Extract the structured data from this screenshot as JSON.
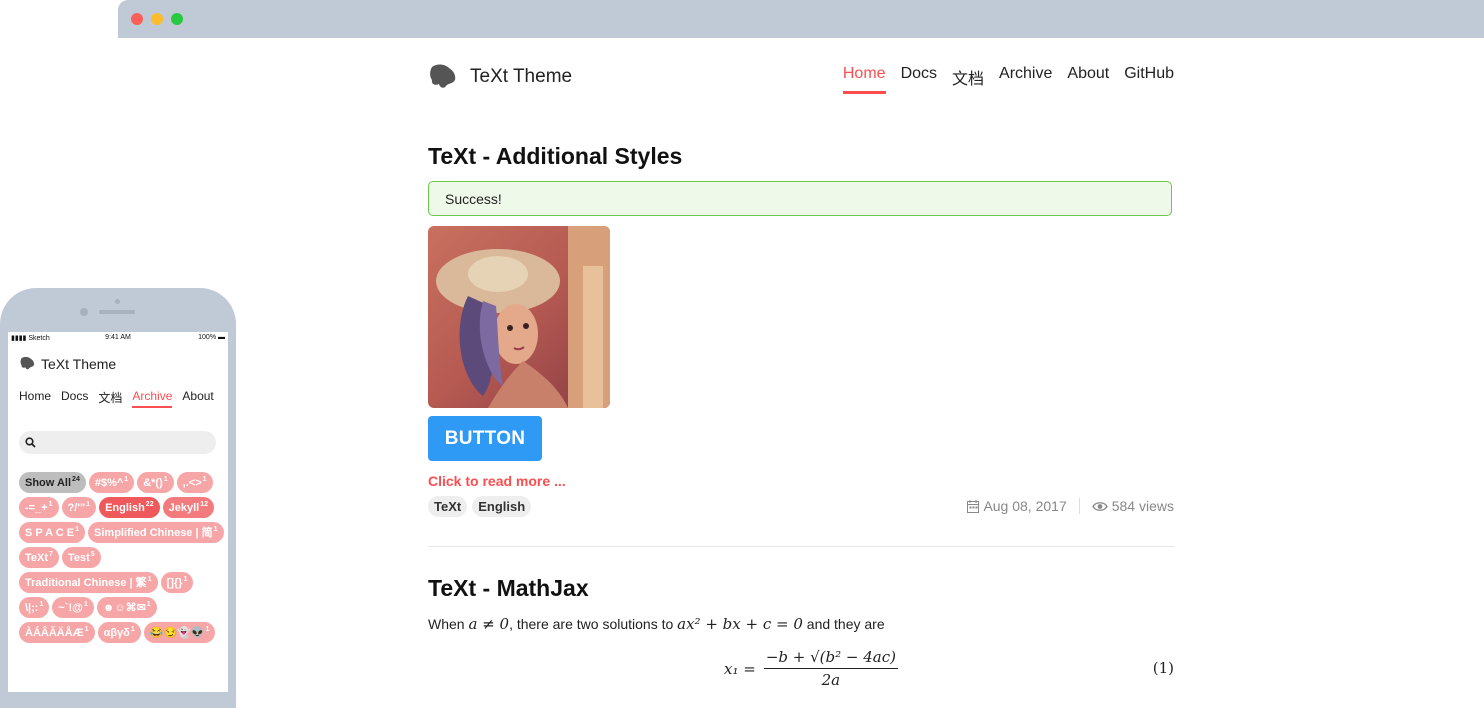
{
  "desktop": {
    "site_title": "TeXt Theme",
    "nav": [
      {
        "label": "Home",
        "active": true
      },
      {
        "label": "Docs",
        "active": false
      },
      {
        "label": "文档",
        "active": false
      },
      {
        "label": "Archive",
        "active": false
      },
      {
        "label": "About",
        "active": false
      },
      {
        "label": "GitHub",
        "active": false
      }
    ],
    "post1": {
      "title": "TeXt - Additional Styles",
      "alert": "Success!",
      "button_label": "BUTTON",
      "read_more": "Click to read more ...",
      "tags": [
        "TeXt",
        "English"
      ],
      "date": "Aug 08, 2017",
      "views": "584 views"
    },
    "post2": {
      "title": "TeXt - MathJax",
      "text_before": "When ",
      "cond": "a ≠ 0",
      "text_mid": ", there are two solutions to ",
      "equation": "ax² + bx + c = 0",
      "text_after": " and they are",
      "formula_lhs": "x₁ =",
      "formula_num": "−b + √(b² − 4ac)",
      "formula_den": "2a",
      "eq_number": "(1)"
    }
  },
  "phone": {
    "status": {
      "left": "Sketch",
      "time": "9:41 AM",
      "battery": "100%"
    },
    "site_title": "TeXt Theme",
    "nav": [
      {
        "label": "Home",
        "active": false
      },
      {
        "label": "Docs",
        "active": false
      },
      {
        "label": "文档",
        "active": false
      },
      {
        "label": "Archive",
        "active": true
      },
      {
        "label": "About",
        "active": false
      }
    ],
    "search_placeholder": "",
    "tags": [
      {
        "label": "Show All",
        "count": "24",
        "style": "all"
      },
      {
        "label": "#$%^",
        "count": "1",
        "style": "light"
      },
      {
        "label": "&*()",
        "count": "1",
        "style": "light"
      },
      {
        "label": ",.<>",
        "count": "1",
        "style": "light"
      },
      {
        "label": "-=_+",
        "count": "1",
        "style": "light"
      },
      {
        "label": "?/'\"",
        "count": "1",
        "style": "light"
      },
      {
        "label": "English",
        "count": "22",
        "style": "hot"
      },
      {
        "label": "Jekyll",
        "count": "12",
        "style": "warm"
      },
      {
        "label": "S P A C E",
        "count": "1",
        "style": "light"
      },
      {
        "label": "Simplified Chinese | 简",
        "count": "1",
        "style": "light"
      },
      {
        "label": "TeXt",
        "count": "7",
        "style": "light"
      },
      {
        "label": "Test",
        "count": "5",
        "style": "light"
      },
      {
        "label": "Traditional Chinese | 繁",
        "count": "1",
        "style": "light"
      },
      {
        "label": "[]{}",
        "count": "1",
        "style": "light"
      },
      {
        "label": "\\|;:",
        "count": "1",
        "style": "light"
      },
      {
        "label": "~`!@",
        "count": "1",
        "style": "light"
      },
      {
        "label": "☻☺⌘✉",
        "count": "1",
        "style": "light"
      },
      {
        "label": "ÀÁÂÃÄÅÆ",
        "count": "1",
        "style": "light"
      },
      {
        "label": "αβγδ",
        "count": "1",
        "style": "light"
      },
      {
        "label": "😂😏👻👽",
        "count": "1",
        "style": "light"
      }
    ]
  },
  "colors": {
    "accent": "#fc4d50",
    "button": "#2f99f6",
    "success_border": "#69c94c",
    "frame": "#c0cad6"
  }
}
